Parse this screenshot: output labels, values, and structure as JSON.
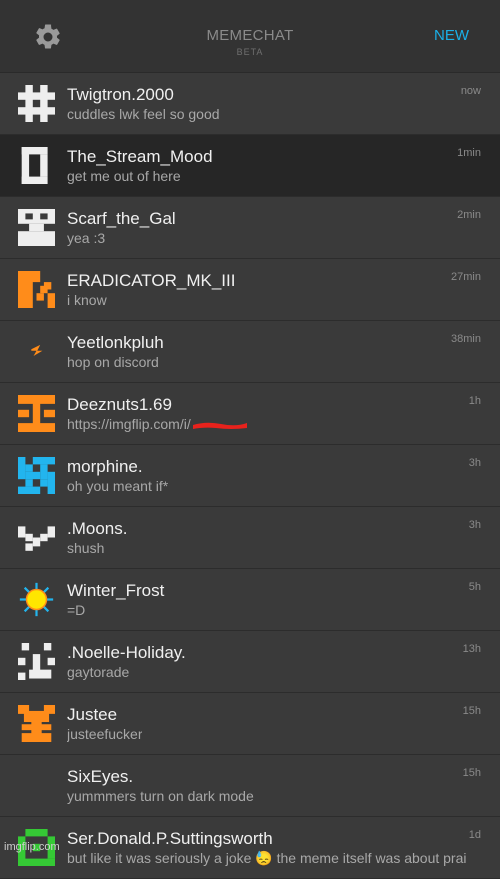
{
  "header": {
    "title": "MEMECHAT",
    "subtitle": "BETA",
    "new_label": "NEW",
    "settings_icon": "gear-icon",
    "accent_color": "#1ab0e8"
  },
  "chats": [
    {
      "name": "Twigtron.2000",
      "message": "cuddles lwk feel so good",
      "time": "now",
      "avatar_color": "#eeeeee"
    },
    {
      "name": "The_Stream_Mood",
      "message": "get me out of here",
      "time": "1min",
      "avatar_color": "#eeeeee"
    },
    {
      "name": "Scarf_the_Gal",
      "message": "yea :3",
      "time": "2min",
      "avatar_color": "#eeeeee"
    },
    {
      "name": "ERADICATOR_MK_III",
      "message": "i know",
      "time": "27min",
      "avatar_color": "#ff8c1a"
    },
    {
      "name": "Yeetlonkpluh",
      "message": "hop on discord",
      "time": "38min",
      "avatar_color": "#ff8c1a"
    },
    {
      "name": "Deeznuts1.69",
      "message": "https://imgflip.com/i/",
      "time": "1h",
      "avatar_color": "#ff8c1a"
    },
    {
      "name": "morphine.",
      "message": "oh you meant if*",
      "time": "3h",
      "avatar_color": "#22b5ee"
    },
    {
      "name": ".Moons.",
      "message": "shush",
      "time": "3h",
      "avatar_color": "#eeeeee"
    },
    {
      "name": "Winter_Frost",
      "message": "=D",
      "time": "5h",
      "avatar_color": "#ffe600"
    },
    {
      "name": ".Noelle-Holiday.",
      "message": "gaytorade",
      "time": "13h",
      "avatar_color": "#eeeeee"
    },
    {
      "name": "Justee",
      "message": "justeefucker",
      "time": "15h",
      "avatar_color": "#ff8c1a"
    },
    {
      "name": "SixEyes.",
      "message": "yummmers turn on dark mode",
      "time": "15h",
      "avatar_color": ""
    },
    {
      "name": "Ser.Donald.P.Suttingsworth",
      "message": "but like it was seriously a joke 😓 the meme itself was about prai",
      "time": "1d",
      "avatar_color": "#35c935"
    }
  ],
  "watermark": "imgflip.com"
}
